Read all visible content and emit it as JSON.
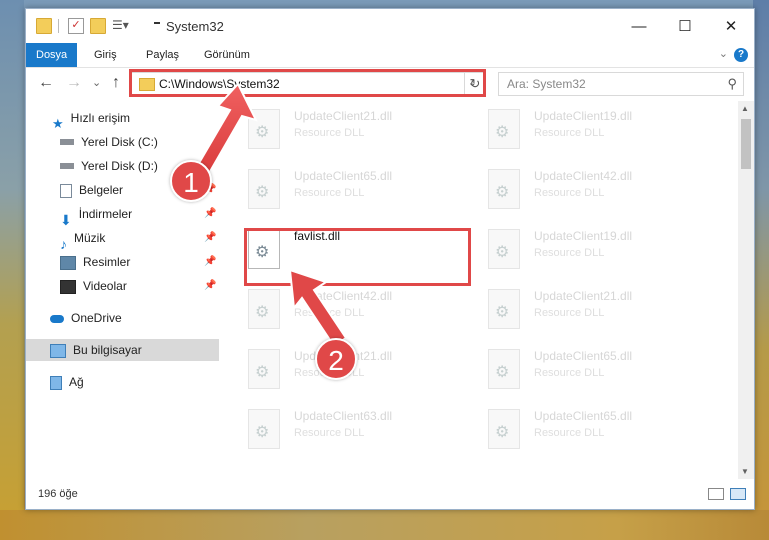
{
  "window": {
    "title": "System32",
    "minimize": "—",
    "maximize": "☐",
    "close": "✕"
  },
  "ribbon": {
    "tabs": [
      "Dosya",
      "Giriş",
      "Paylaş",
      "Görünüm"
    ],
    "help": "?",
    "collapse": "⌄"
  },
  "nav": {
    "back": "←",
    "forward": "→",
    "recent": "⌄",
    "up": "↑",
    "address": "C:\\Windows\\System32",
    "address_dropdown": "⌄",
    "refresh": "↻",
    "search_placeholder": "Ara: System32",
    "search_icon": "⚲"
  },
  "sidebar": {
    "quick_access": "Hızlı erişim",
    "items": [
      {
        "label": "Yerel Disk (C:)",
        "icon": "drive-icon"
      },
      {
        "label": "Yerel Disk (D:)",
        "icon": "drive-icon"
      },
      {
        "label": "Belgeler",
        "icon": "documents-icon"
      },
      {
        "label": "İndirmeler",
        "icon": "downloads-icon"
      },
      {
        "label": "Müzik",
        "icon": "music-icon"
      },
      {
        "label": "Resimler",
        "icon": "pictures-icon"
      },
      {
        "label": "Videolar",
        "icon": "videos-icon"
      }
    ],
    "onedrive": "OneDrive",
    "this_pc": "Bu bilgisayar",
    "network": "Ağ"
  },
  "files": [
    {
      "name": "UpdateClient21.dll",
      "type": "Resource DLL"
    },
    {
      "name": "UpdateClient19.dll",
      "type": "Resource DLL"
    },
    {
      "name": "UpdateClient65.dll",
      "type": "Resource DLL"
    },
    {
      "name": "UpdateClient42.dll",
      "type": "Resource DLL"
    },
    {
      "name": "favlist.dll",
      "type": ""
    },
    {
      "name": "UpdateClient19.dll",
      "type": "Resource DLL"
    },
    {
      "name": "UpdateClient42.dll",
      "type": "Resource DLL"
    },
    {
      "name": "UpdateClient21.dll",
      "type": "Resource DLL"
    },
    {
      "name": "UpdateClient21.dll",
      "type": "Resource DLL"
    },
    {
      "name": "UpdateClient65.dll",
      "type": "Resource DLL"
    },
    {
      "name": "UpdateClient63.dll",
      "type": "Resource DLL"
    },
    {
      "name": "UpdateClient65.dll",
      "type": "Resource DLL"
    }
  ],
  "status": {
    "count": "196 öğe"
  },
  "annotations": {
    "step1": "1",
    "step2": "2",
    "accent": "#e04848"
  }
}
